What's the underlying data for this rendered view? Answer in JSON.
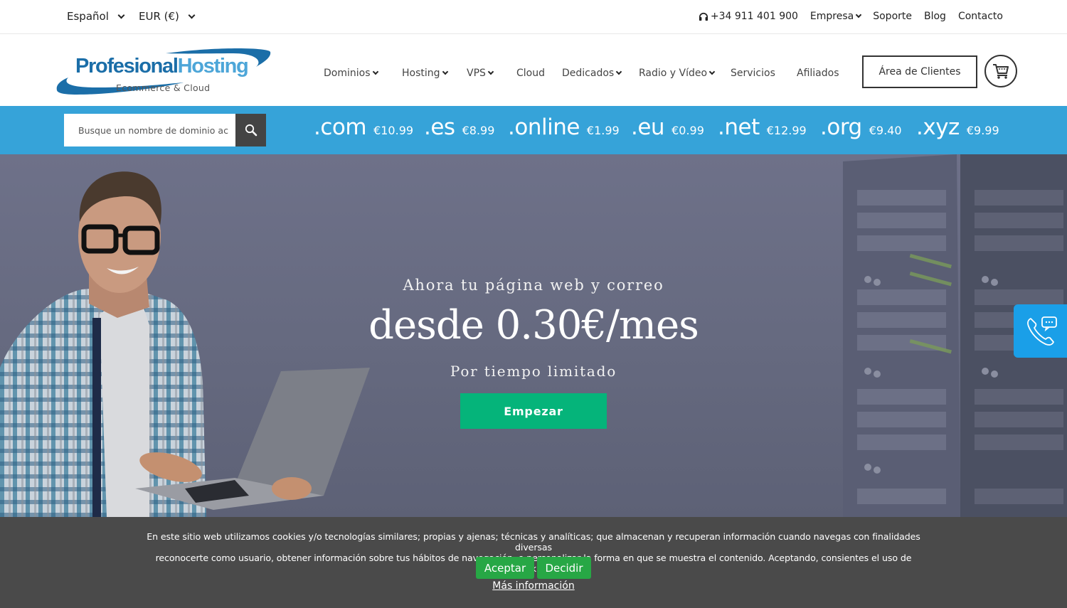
{
  "topbar": {
    "language": "Español",
    "currency": "EUR (€)",
    "phone": "+34 911 401 900",
    "links": [
      "Empresa",
      "Soporte",
      "Blog",
      "Contacto"
    ]
  },
  "logo": {
    "brand_part1": "Profesional",
    "brand_part2": "Hosting",
    "tagline": "Ecommerce & Cloud"
  },
  "nav": {
    "items": [
      {
        "label": "Dominios",
        "dropdown": true
      },
      {
        "label": "Hosting",
        "dropdown": true
      },
      {
        "label": "VPS",
        "dropdown": true
      },
      {
        "label": "Cloud",
        "dropdown": false
      },
      {
        "label": "Dedicados",
        "dropdown": true
      },
      {
        "label": "Radio y Vídeo",
        "dropdown": true
      },
      {
        "label": "Servicios",
        "dropdown": false
      },
      {
        "label": "Afiliados",
        "dropdown": false
      }
    ],
    "client_area": "Área de Clientes",
    "cart_icon": "shopping-cart-icon"
  },
  "domain_search": {
    "placeholder": "Busque un nombre de dominio ac",
    "tlds": [
      {
        "ext": ".com",
        "price": "€10.99"
      },
      {
        "ext": ".es",
        "price": "€8.99"
      },
      {
        "ext": ".online",
        "price": "€1.99"
      },
      {
        "ext": ".eu",
        "price": "€0.99"
      },
      {
        "ext": ".net",
        "price": "€12.99"
      },
      {
        "ext": ".org",
        "price": "€9.40"
      },
      {
        "ext": ".xyz",
        "price": "€9.99"
      }
    ]
  },
  "hero": {
    "subtitle": "Ahora tu página web y correo",
    "title": "desde 0.30€/mes",
    "limited": "Por tiempo limitado",
    "cta": "Empezar"
  },
  "cookie": {
    "line1": "En este sitio web utilizamos cookies y/o tecnologías similares; propias y ajenas; técnicas y analíticas; que almacenan y recuperan información cuando navegas con finalidades diversas",
    "line2": "reconocerte como usuario, obtener información sobre tus hábitos de navegación, o personalizar la forma en que se muestra el contenido. Aceptando, consientes el uso de cookies.",
    "accept": "Aceptar",
    "decide": "Decidir",
    "more": "Más información"
  },
  "colors": {
    "brand_blue": "#1b6ea8",
    "domain_bar": "#36a3d9",
    "cta_green": "#05b47a",
    "cookie_green": "#27a745",
    "contact_float": "#1a9fe8"
  }
}
